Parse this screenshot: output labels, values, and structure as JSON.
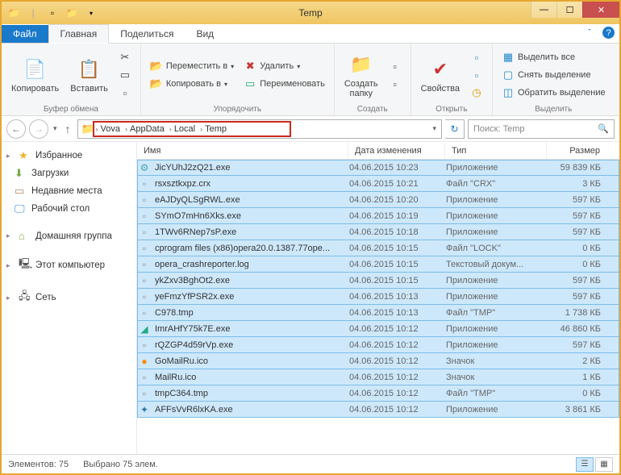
{
  "window": {
    "title": "Temp"
  },
  "tabs": {
    "file": "Файл",
    "home": "Главная",
    "share": "Поделиться",
    "view": "Вид"
  },
  "ribbon": {
    "clipboard": {
      "label": "Буфер обмена",
      "copy": "Копировать",
      "paste": "Вставить"
    },
    "organize": {
      "label": "Упорядочить",
      "moveto": "Переместить в",
      "copyto": "Копировать в",
      "delete": "Удалить",
      "rename": "Переименовать"
    },
    "new": {
      "label": "Создать",
      "newfolder": "Создать\nпапку"
    },
    "open": {
      "label": "Открыть",
      "properties": "Свойства"
    },
    "select": {
      "label": "Выделить",
      "selectall": "Выделить все",
      "selectnone": "Снять выделение",
      "invert": "Обратить выделение"
    }
  },
  "breadcrumbs": [
    "Vova",
    "AppData",
    "Local",
    "Temp"
  ],
  "search": {
    "placeholder": "Поиск: Temp"
  },
  "nav": {
    "favorites": "Избранное",
    "downloads": "Загрузки",
    "recent": "Недавние места",
    "desktop": "Рабочий стол",
    "homegroup": "Домашняя группа",
    "thispc": "Этот компьютер",
    "network": "Сеть"
  },
  "columns": {
    "name": "Имя",
    "modified": "Дата изменения",
    "type": "Тип",
    "size": "Размер"
  },
  "files": [
    {
      "ic": "⚙",
      "col": "#4aa",
      "name": "JicYUhJ2zQ21.exe",
      "date": "04.06.2015 10:23",
      "type": "Приложение",
      "size": "59 839 КБ",
      "sel": true
    },
    {
      "ic": "▫",
      "col": "#888",
      "name": "rsxsztkxpz.crx",
      "date": "04.06.2015 10:21",
      "type": "Файл \"CRX\"",
      "size": "3 КБ",
      "sel": false
    },
    {
      "ic": "▫",
      "col": "#888",
      "name": "eAJDyQLSgRWL.exe",
      "date": "04.06.2015 10:20",
      "type": "Приложение",
      "size": "597 КБ",
      "sel": true
    },
    {
      "ic": "▫",
      "col": "#888",
      "name": "SYmO7mHn6Xks.exe",
      "date": "04.06.2015 10:19",
      "type": "Приложение",
      "size": "597 КБ",
      "sel": true
    },
    {
      "ic": "▫",
      "col": "#888",
      "name": "1TWv6RNep7sP.exe",
      "date": "04.06.2015 10:18",
      "type": "Приложение",
      "size": "597 КБ",
      "sel": true
    },
    {
      "ic": "▫",
      "col": "#888",
      "name": "cprogram files (x86)opera20.0.1387.77ope...",
      "date": "04.06.2015 10:15",
      "type": "Файл \"LOCK\"",
      "size": "0 КБ",
      "sel": false
    },
    {
      "ic": "▫",
      "col": "#888",
      "name": "opera_crashreporter.log",
      "date": "04.06.2015 10:15",
      "type": "Текстовый докум...",
      "size": "0 КБ",
      "sel": false
    },
    {
      "ic": "▫",
      "col": "#888",
      "name": "ykZxv3BghOt2.exe",
      "date": "04.06.2015 10:15",
      "type": "Приложение",
      "size": "597 КБ",
      "sel": true
    },
    {
      "ic": "▫",
      "col": "#888",
      "name": "yeFmzYfPSR2x.exe",
      "date": "04.06.2015 10:13",
      "type": "Приложение",
      "size": "597 КБ",
      "sel": true
    },
    {
      "ic": "▫",
      "col": "#888",
      "name": "C978.tmp",
      "date": "04.06.2015 10:13",
      "type": "Файл \"TMP\"",
      "size": "1 738 КБ",
      "sel": false
    },
    {
      "ic": "◢",
      "col": "#2a8",
      "name": "ImrAHfY75k7E.exe",
      "date": "04.06.2015 10:12",
      "type": "Приложение",
      "size": "46 860 КБ",
      "sel": true
    },
    {
      "ic": "▫",
      "col": "#888",
      "name": "rQZGP4d59rVp.exe",
      "date": "04.06.2015 10:12",
      "type": "Приложение",
      "size": "597 КБ",
      "sel": true
    },
    {
      "ic": "●",
      "col": "#f80",
      "name": "GoMailRu.ico",
      "date": "04.06.2015 10:12",
      "type": "Значок",
      "size": "2 КБ",
      "sel": false
    },
    {
      "ic": "▫",
      "col": "#888",
      "name": "MailRu.ico",
      "date": "04.06.2015 10:12",
      "type": "Значок",
      "size": "1 КБ",
      "sel": false
    },
    {
      "ic": "▫",
      "col": "#888",
      "name": "tmpC364.tmp",
      "date": "04.06.2015 10:12",
      "type": "Файл \"TMP\"",
      "size": "0 КБ",
      "sel": false
    },
    {
      "ic": "✦",
      "col": "#37a",
      "name": "AFFsVvR6lxKA.exe",
      "date": "04.06.2015 10:12",
      "type": "Приложение",
      "size": "3 861 КБ",
      "sel": true
    }
  ],
  "status": {
    "count": "Элементов: 75",
    "selected": "Выбрано 75 элем."
  }
}
